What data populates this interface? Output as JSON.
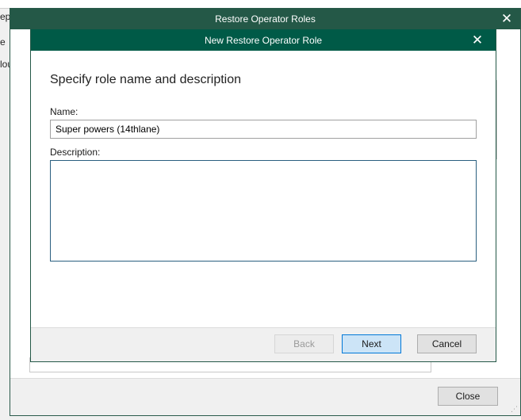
{
  "background": {
    "fragment_1": "ep",
    "fragment_2": "e",
    "fragment_3": "lou"
  },
  "outer_dialog": {
    "title": "Restore Operator Roles",
    "close_glyph": "✕",
    "close_button_label": "Close"
  },
  "inner_dialog": {
    "title": "New Restore Operator Role",
    "close_glyph": "✕",
    "heading": "Specify role name and description",
    "name_label": "Name:",
    "name_value": "Super powers (14thlane)",
    "description_label": "Description:",
    "description_value": "",
    "buttons": {
      "back": "Back",
      "next": "Next",
      "cancel": "Cancel"
    }
  }
}
